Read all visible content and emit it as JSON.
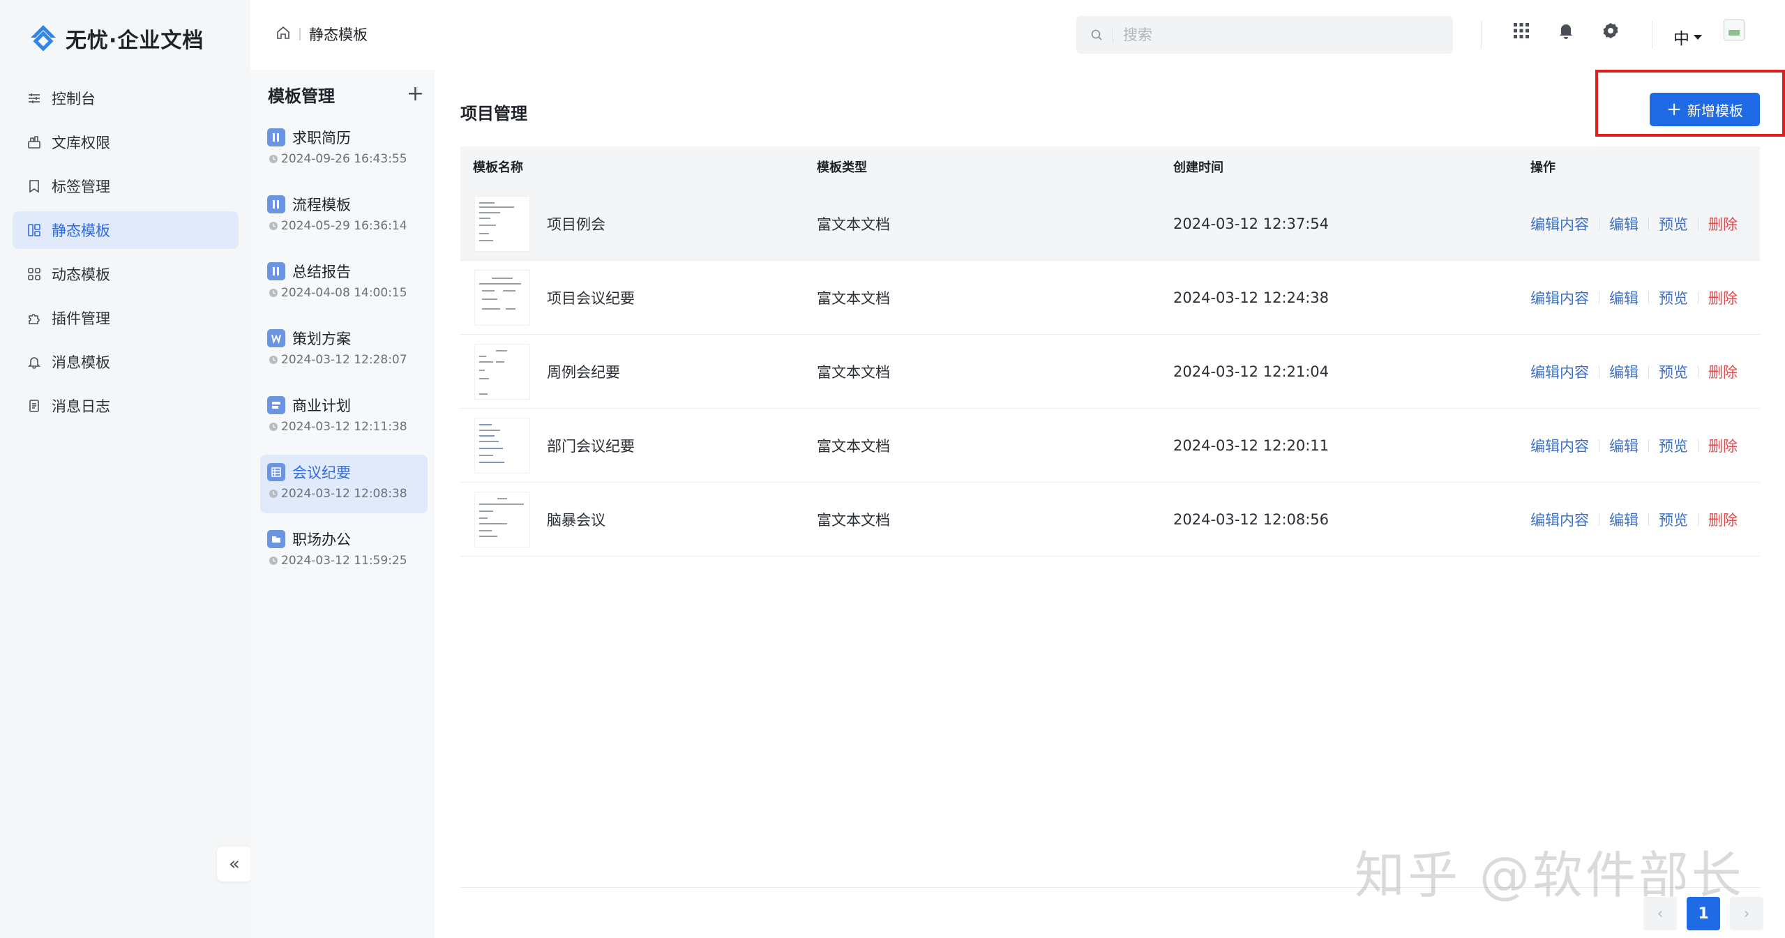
{
  "app": {
    "brand": "无忧·企业文档",
    "accent": "#1f6be6"
  },
  "sidebar": {
    "items": [
      {
        "label": "控制台",
        "icon": "sliders-icon"
      },
      {
        "label": "文库权限",
        "icon": "library-icon"
      },
      {
        "label": "标签管理",
        "icon": "bookmark-icon"
      },
      {
        "label": "静态模板",
        "icon": "layout-icon",
        "active": true
      },
      {
        "label": "动态模板",
        "icon": "grid-icon"
      },
      {
        "label": "插件管理",
        "icon": "puzzle-icon"
      },
      {
        "label": "消息模板",
        "icon": "bell-icon"
      },
      {
        "label": "消息日志",
        "icon": "log-icon"
      }
    ],
    "collapse_label": "«"
  },
  "topbar": {
    "breadcrumb": "静态模板",
    "search_placeholder": "搜索",
    "lang": "中"
  },
  "templates": {
    "title": "模板管理",
    "add_label": "+",
    "items": [
      {
        "name": "求职简历",
        "time": "2024-09-26 16:43:55",
        "icon": "columns-icon"
      },
      {
        "name": "流程模板",
        "time": "2024-05-29 16:36:14",
        "icon": "columns-icon"
      },
      {
        "name": "总结报告",
        "time": "2024-04-08 14:00:15",
        "icon": "columns-icon"
      },
      {
        "name": "策划方案",
        "time": "2024-03-12 12:28:07",
        "icon": "word-icon"
      },
      {
        "name": "商业计划",
        "time": "2024-03-12 12:11:38",
        "icon": "signpost-icon"
      },
      {
        "name": "会议纪要",
        "time": "2024-03-12 12:08:38",
        "icon": "table-icon",
        "active": true
      },
      {
        "name": "职场办公",
        "time": "2024-03-12 11:59:25",
        "icon": "folder-icon"
      }
    ]
  },
  "main": {
    "title": "项目管理",
    "add_button": "新增模板",
    "columns": [
      "模板名称",
      "模板类型",
      "创建时间",
      "操作"
    ],
    "rows": [
      {
        "name": "项目例会",
        "type": "富文本文档",
        "created": "2024-03-12 12:37:54"
      },
      {
        "name": "项目会议纪要",
        "type": "富文本文档",
        "created": "2024-03-12 12:24:38"
      },
      {
        "name": "周例会纪要",
        "type": "富文本文档",
        "created": "2024-03-12 12:21:04"
      },
      {
        "name": "部门会议纪要",
        "type": "富文本文档",
        "created": "2024-03-12 12:20:11"
      },
      {
        "name": "脑暴会议",
        "type": "富文本文档",
        "created": "2024-03-12 12:08:56"
      }
    ],
    "ops": {
      "edit_content": "编辑内容",
      "edit": "编辑",
      "preview": "预览",
      "delete": "删除"
    },
    "pagination": {
      "prev": "‹",
      "current": "1",
      "next": "›"
    }
  },
  "watermark": "知乎 @软件部长"
}
